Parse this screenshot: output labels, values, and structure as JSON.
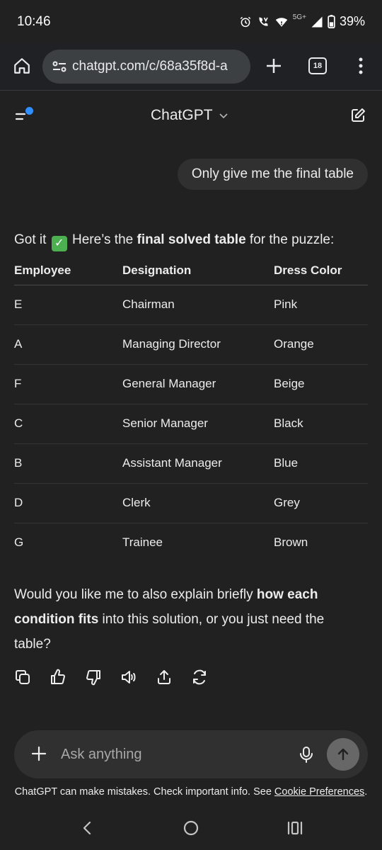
{
  "status_bar": {
    "time": "10:46",
    "network_label": "5G+",
    "battery": "39%"
  },
  "browser": {
    "url": "chatgpt.com/c/68a35f8d-a",
    "tab_count": "18"
  },
  "app": {
    "title": "ChatGPT"
  },
  "chat": {
    "user_message": "Only give me the final table",
    "intro_prefix": "Got it",
    "intro_middle": " Here’s the ",
    "intro_bold": "final solved table",
    "intro_suffix": " for the puzzle:",
    "table": {
      "headers": [
        "Employee",
        "Designation",
        "Dress Color"
      ],
      "rows": [
        [
          "E",
          "Chairman",
          "Pink"
        ],
        [
          "A",
          "Managing Director",
          "Orange"
        ],
        [
          "F",
          "General Manager",
          "Beige"
        ],
        [
          "C",
          "Senior Manager",
          "Black"
        ],
        [
          "B",
          "Assistant Manager",
          "Blue"
        ],
        [
          "D",
          "Clerk",
          "Grey"
        ],
        [
          "G",
          "Trainee",
          "Brown"
        ]
      ]
    },
    "followup_prefix": "Would you like me to also explain briefly ",
    "followup_bold": "how each condition fits",
    "followup_suffix": " into this solution, or you just need the table?"
  },
  "composer": {
    "placeholder": "Ask anything"
  },
  "disclaimer": {
    "text": "ChatGPT can make mistakes. Check important info. See ",
    "link": "Cookie Preferences",
    "end": "."
  },
  "colors": {
    "background": "#212121",
    "bubble": "#303030",
    "accent_dot": "#2f8fff",
    "check_emoji": "#4caf50"
  }
}
